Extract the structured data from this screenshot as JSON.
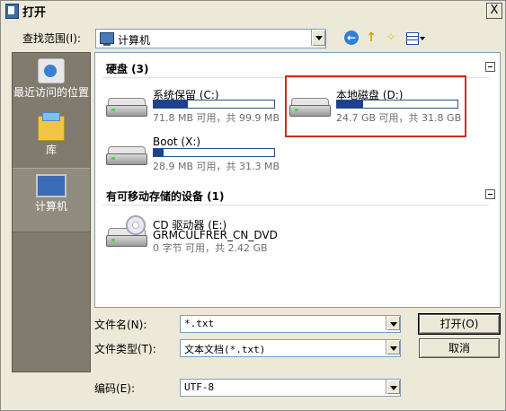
{
  "window": {
    "title": "打开",
    "close_glyph": "X"
  },
  "lookin": {
    "label": "查找范围(I):",
    "value": "计算机"
  },
  "toolbar": {
    "back_glyph": "←",
    "up_glyph": "↑",
    "newfolder_glyph": "✧"
  },
  "places": {
    "recent": "最近访问的位置",
    "library": "库",
    "computer": "计算机"
  },
  "groups": {
    "hard_disks": "硬盘 (3)",
    "removable": "有可移动存储的设备 (1)"
  },
  "drives": {
    "c": {
      "name": "系统保留 (C:)",
      "info": "71.8 MB 可用，共 99.9 MB",
      "used_fraction": 0.28
    },
    "d": {
      "name": "本地磁盘 (D:)",
      "info": "24.7 GB 可用，共 31.8 GB",
      "used_fraction": 0.22
    },
    "x": {
      "name": "Boot (X:)",
      "info": "28.9 MB 可用，共 31.3 MB",
      "used_fraction": 0.08
    },
    "e": {
      "name": "CD 驱动器 (E:)",
      "label": "GRMCULFRER_CN_DVD",
      "info": "0 字节 可用，共 2.42 GB"
    }
  },
  "form": {
    "filename_label": "文件名(N):",
    "filename_value": "*.txt",
    "filetype_label": "文件类型(T):",
    "filetype_value": "文本文档(*.txt)",
    "encoding_label": "编码(E):",
    "encoding_value": "UTF-8",
    "open_button": "打开(O)",
    "cancel_button": "取消"
  }
}
